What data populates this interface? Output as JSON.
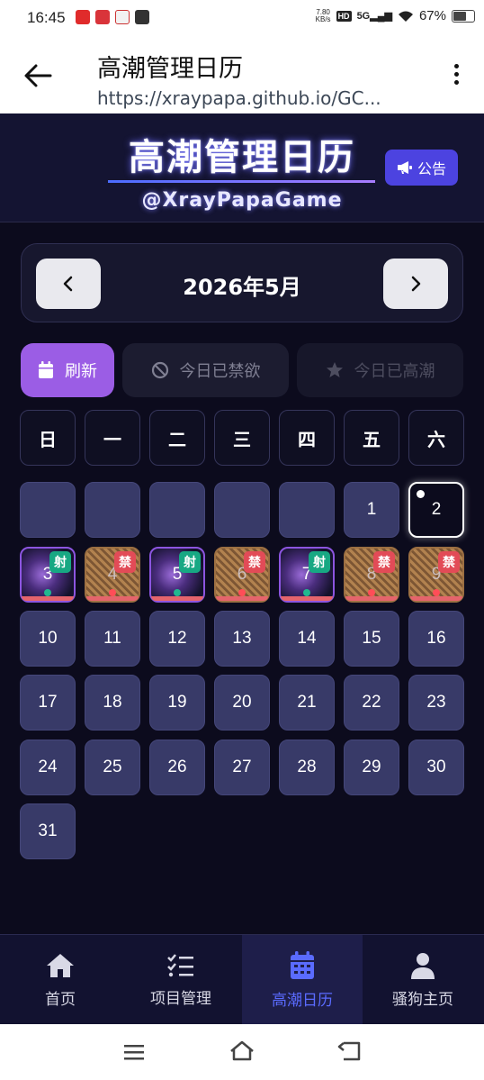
{
  "status_bar": {
    "time": "16:45",
    "net_speed_value": "7.80",
    "net_speed_unit": "KB/s",
    "hd": "HD",
    "signal": "5G",
    "battery": "67%"
  },
  "browser": {
    "title": "高潮管理日历",
    "url": "https://xraypapa.github.io/GC..."
  },
  "header": {
    "title": "高潮管理日历",
    "handle": "@XrayPapaGame",
    "notice_label": "公告"
  },
  "calendar": {
    "month_label": "2026年5月",
    "weekdays": [
      "日",
      "一",
      "二",
      "三",
      "四",
      "五",
      "六"
    ],
    "badge_shoot": "射",
    "badge_ban": "禁",
    "days": [
      "1",
      "2",
      "3",
      "4",
      "5",
      "6",
      "7",
      "8",
      "9",
      "10",
      "11",
      "12",
      "13",
      "14",
      "15",
      "16",
      "17",
      "18",
      "19",
      "20",
      "21",
      "22",
      "23",
      "24",
      "25",
      "26",
      "27",
      "28",
      "29",
      "30",
      "31"
    ]
  },
  "actions": {
    "refresh": "刷新",
    "abstain": "今日已禁欲",
    "climax": "今日已高潮"
  },
  "nav": {
    "home": "首页",
    "projects": "项目管理",
    "calendar": "高潮日历",
    "profile": "骚狗主页"
  },
  "colors": {
    "accent": "#9b5de5",
    "nav_active": "#5a6bff",
    "notice": "#4c43e0",
    "shoot_badge": "#17a883",
    "ban_badge": "#e24b57"
  }
}
